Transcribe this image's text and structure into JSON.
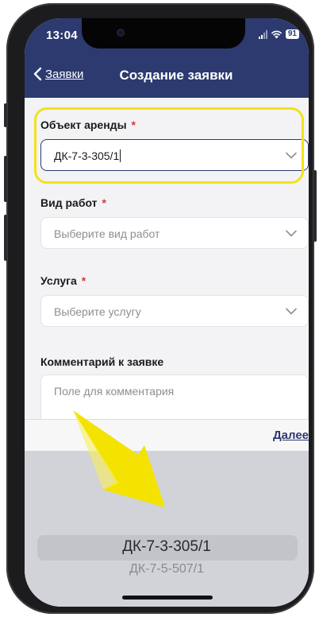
{
  "status_bar": {
    "time": "13:04",
    "battery": "91"
  },
  "navbar": {
    "back_label": "Заявки",
    "title": "Создание заявки"
  },
  "form": {
    "rental_object": {
      "label": "Объект аренды",
      "required_mark": "*",
      "value": "ДК-7-3-305/1"
    },
    "work_type": {
      "label": "Вид работ",
      "required_mark": "*",
      "placeholder": "Выберите вид работ"
    },
    "service": {
      "label": "Услуга",
      "required_mark": "*",
      "placeholder": "Выберите услугу"
    },
    "comment": {
      "label": "Комментарий к заявке",
      "placeholder": "Поле для комментария"
    }
  },
  "toolbar": {
    "next_label": "Далее"
  },
  "picker": {
    "selected": "ДК-7-3-305/1",
    "next_option": "ДК-7-5-507/1"
  },
  "colors": {
    "brand": "#2c3a70",
    "highlight": "#f2e21a",
    "required": "#d23b3b"
  },
  "icons": {
    "back": "chevron-left-icon",
    "dropdown": "chevron-down-icon",
    "signal": "signal-icon",
    "wifi": "wifi-icon",
    "battery": "battery-icon",
    "annotation": "arrow-annotation-icon"
  }
}
